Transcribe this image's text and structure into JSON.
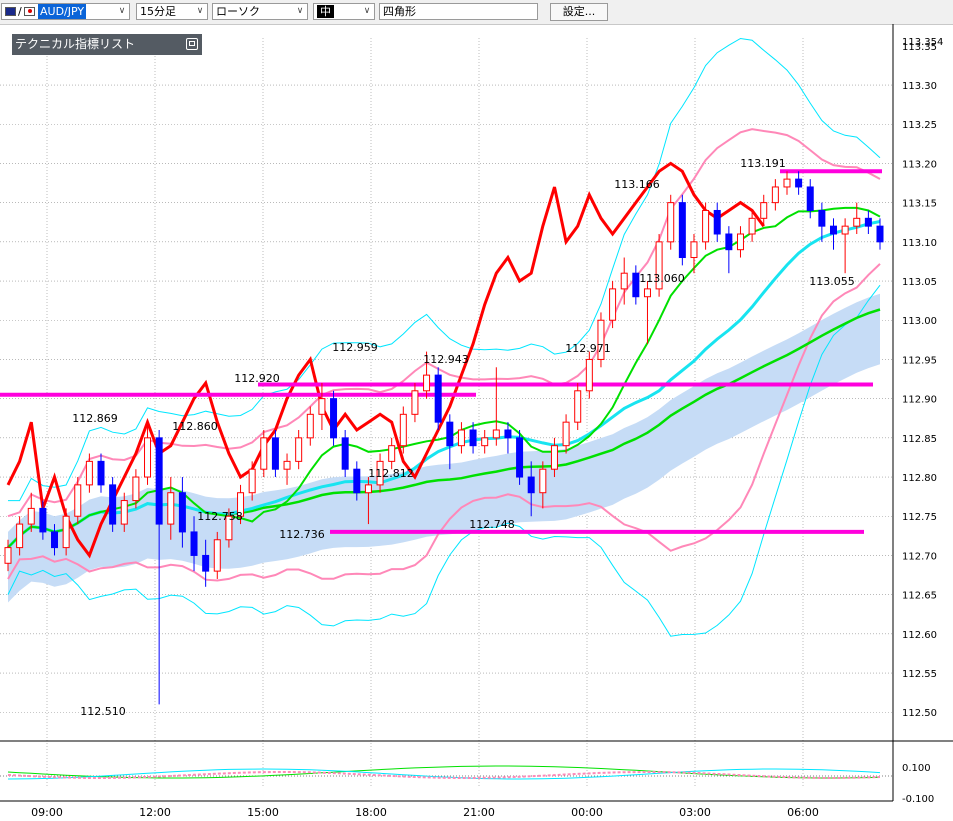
{
  "toolbar": {
    "pair_prefix": "/",
    "pair": "AUD/JPY",
    "timeframe": "15分足",
    "chart_style": "ローソク",
    "line_weight": "中",
    "drawing_shape": "四角形",
    "settings_button": "設定..."
  },
  "technical_panel": {
    "title": "テクニカル指標リスト"
  },
  "colors": {
    "candle_up": "#ff0000",
    "candle_down": "#0000ff",
    "cloud": "#c6dcf6",
    "bb_outer": "#00e6ff",
    "bb_inner": "#ff88b8",
    "ma_cyan": "#18e4f0",
    "ma_green": "#00e000",
    "lagging_red": "#ff0000",
    "horizontal_lines": "#ff00dd",
    "grid": "#909090"
  },
  "chart_data": {
    "type": "candlestick",
    "symbol": "AUD/JPY",
    "timeframe": "15分足",
    "y_axis_ticks": [
      "113.30",
      "113.25",
      "113.20",
      "113.15",
      "113.10",
      "113.05",
      "113.00",
      "112.95",
      "112.90",
      "112.85",
      "112.80",
      "112.75",
      "112.70",
      "112.65",
      "112.60",
      "112.55",
      "112.50"
    ],
    "y_top_labels": [
      "113.354",
      "113.35"
    ],
    "ylim": [
      112.485,
      113.36
    ],
    "x_axis_ticks": [
      "09:00",
      "12:00",
      "15:00",
      "18:00",
      "21:00",
      "00:00",
      "03:00",
      "06:00"
    ],
    "annotations": [
      {
        "label": "112.869",
        "value": 112.869
      },
      {
        "label": "112.860",
        "value": 112.86
      },
      {
        "label": "112.920",
        "value": 112.92
      },
      {
        "label": "112.959",
        "value": 112.959
      },
      {
        "label": "112.943",
        "value": 112.943
      },
      {
        "label": "113.166",
        "value": 113.166
      },
      {
        "label": "113.191",
        "value": 113.191
      },
      {
        "label": "113.060",
        "value": 113.06
      },
      {
        "label": "113.055",
        "value": 113.055
      },
      {
        "label": "112.971",
        "value": 112.971
      },
      {
        "label": "112.812",
        "value": 112.812
      },
      {
        "label": "112.758",
        "value": 112.758
      },
      {
        "label": "112.736",
        "value": 112.736
      },
      {
        "label": "112.748",
        "value": 112.748
      },
      {
        "label": "112.510",
        "value": 112.51
      }
    ],
    "horizontal_levels": [
      112.905,
      112.918,
      112.73,
      113.19
    ],
    "candles_ohlc": [
      [
        112.69,
        112.72,
        112.68,
        112.71
      ],
      [
        112.71,
        112.75,
        112.7,
        112.74
      ],
      [
        112.74,
        112.78,
        112.73,
        112.76
      ],
      [
        112.76,
        112.77,
        112.72,
        112.73
      ],
      [
        112.73,
        112.74,
        112.7,
        112.71
      ],
      [
        112.71,
        112.76,
        112.7,
        112.75
      ],
      [
        112.75,
        112.8,
        112.74,
        112.79
      ],
      [
        112.79,
        112.83,
        112.78,
        112.82
      ],
      [
        112.82,
        112.83,
        112.78,
        112.79
      ],
      [
        112.79,
        112.8,
        112.73,
        112.74
      ],
      [
        112.74,
        112.78,
        112.73,
        112.77
      ],
      [
        112.77,
        112.81,
        112.76,
        112.8
      ],
      [
        112.8,
        112.87,
        112.79,
        112.85
      ],
      [
        112.85,
        112.86,
        112.51,
        112.74
      ],
      [
        112.74,
        112.8,
        112.72,
        112.78
      ],
      [
        112.78,
        112.8,
        112.71,
        112.73
      ],
      [
        112.73,
        112.75,
        112.68,
        112.7
      ],
      [
        112.7,
        112.72,
        112.66,
        112.68
      ],
      [
        112.68,
        112.73,
        112.67,
        112.72
      ],
      [
        112.72,
        112.76,
        112.71,
        112.75
      ],
      [
        112.75,
        112.79,
        112.74,
        112.78
      ],
      [
        112.78,
        112.82,
        112.77,
        112.81
      ],
      [
        112.81,
        112.86,
        112.8,
        112.85
      ],
      [
        112.85,
        112.86,
        112.8,
        112.81
      ],
      [
        112.81,
        112.83,
        112.79,
        112.82
      ],
      [
        112.82,
        112.86,
        112.81,
        112.85
      ],
      [
        112.85,
        112.89,
        112.84,
        112.88
      ],
      [
        112.88,
        112.92,
        112.86,
        112.9
      ],
      [
        112.9,
        112.91,
        112.84,
        112.85
      ],
      [
        112.85,
        112.86,
        112.8,
        112.81
      ],
      [
        112.81,
        112.82,
        112.77,
        112.78
      ],
      [
        112.78,
        112.8,
        112.74,
        112.79
      ],
      [
        112.79,
        112.83,
        112.78,
        112.82
      ],
      [
        112.82,
        112.85,
        112.81,
        112.84
      ],
      [
        112.84,
        112.89,
        112.83,
        112.88
      ],
      [
        112.88,
        112.92,
        112.87,
        112.91
      ],
      [
        112.91,
        112.96,
        112.9,
        112.93
      ],
      [
        112.93,
        112.94,
        112.86,
        112.87
      ],
      [
        112.87,
        112.88,
        112.81,
        112.84
      ],
      [
        112.84,
        112.87,
        112.83,
        112.86
      ],
      [
        112.86,
        112.87,
        112.83,
        112.84
      ],
      [
        112.84,
        112.86,
        112.83,
        112.85
      ],
      [
        112.85,
        112.94,
        112.84,
        112.86
      ],
      [
        112.86,
        112.87,
        112.83,
        112.85
      ],
      [
        112.85,
        112.86,
        112.79,
        112.8
      ],
      [
        112.8,
        112.82,
        112.75,
        112.78
      ],
      [
        112.78,
        112.82,
        112.76,
        112.81
      ],
      [
        112.81,
        112.85,
        112.8,
        112.84
      ],
      [
        112.84,
        112.88,
        112.83,
        112.87
      ],
      [
        112.87,
        112.92,
        112.86,
        112.91
      ],
      [
        112.91,
        112.96,
        112.9,
        112.95
      ],
      [
        112.95,
        113.01,
        112.94,
        113.0
      ],
      [
        113.0,
        113.05,
        112.99,
        113.04
      ],
      [
        113.04,
        113.08,
        113.02,
        113.06
      ],
      [
        113.06,
        113.07,
        113.02,
        113.03
      ],
      [
        113.03,
        113.05,
        112.97,
        113.04
      ],
      [
        113.04,
        113.11,
        113.03,
        113.1
      ],
      [
        113.1,
        113.16,
        113.09,
        113.15
      ],
      [
        113.15,
        113.16,
        113.07,
        113.08
      ],
      [
        113.08,
        113.11,
        113.06,
        113.1
      ],
      [
        113.1,
        113.15,
        113.09,
        113.14
      ],
      [
        113.14,
        113.15,
        113.1,
        113.11
      ],
      [
        113.11,
        113.12,
        113.06,
        113.09
      ],
      [
        113.09,
        113.12,
        113.08,
        113.11
      ],
      [
        113.11,
        113.14,
        113.1,
        113.13
      ],
      [
        113.13,
        113.16,
        113.12,
        113.15
      ],
      [
        113.15,
        113.18,
        113.14,
        113.17
      ],
      [
        113.17,
        113.19,
        113.16,
        113.18
      ],
      [
        113.18,
        113.19,
        113.16,
        113.17
      ],
      [
        113.17,
        113.18,
        113.13,
        113.14
      ],
      [
        113.14,
        113.15,
        113.1,
        113.12
      ],
      [
        113.12,
        113.13,
        113.09,
        113.11
      ],
      [
        113.11,
        113.13,
        113.06,
        113.12
      ],
      [
        113.12,
        113.15,
        113.11,
        113.13
      ],
      [
        113.13,
        113.14,
        113.11,
        113.12
      ],
      [
        113.12,
        113.13,
        113.09,
        113.1
      ]
    ]
  }
}
